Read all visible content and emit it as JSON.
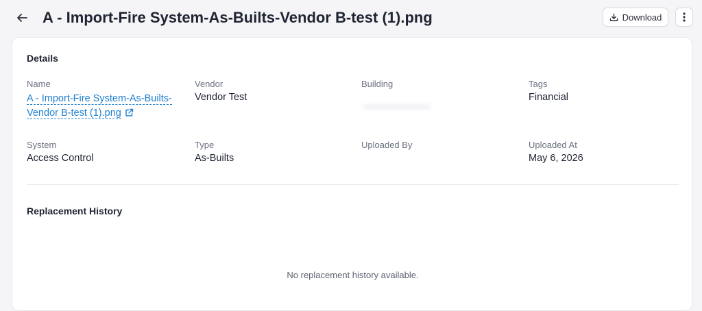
{
  "header": {
    "title": "A - Import-Fire System-As-Builts-Vendor B-test (1).png",
    "download_label": "Download"
  },
  "details": {
    "section_title": "Details",
    "name": {
      "label": "Name",
      "value": "A - Import-Fire System-As-Builts-Vendor B-test (1).png"
    },
    "vendor": {
      "label": "Vendor",
      "value": "Vendor Test"
    },
    "building": {
      "label": "Building",
      "value": ""
    },
    "tags": {
      "label": "Tags",
      "value": "Financial"
    },
    "system": {
      "label": "System",
      "value": "Access Control"
    },
    "type": {
      "label": "Type",
      "value": "As-Builts"
    },
    "uploaded_by": {
      "label": "Uploaded By",
      "value": ""
    },
    "uploaded_at": {
      "label": "Uploaded At",
      "value": "May 6, 2026"
    }
  },
  "replacement_history": {
    "section_title": "Replacement History",
    "empty_message": "No replacement history available."
  },
  "icons": {
    "back": "arrow-left-icon",
    "download": "download-icon",
    "more": "more-vertical-icon",
    "external_link": "external-link-icon"
  },
  "colors": {
    "link": "#1f7fd0",
    "background": "#f5f5f7",
    "card": "#ffffff"
  }
}
